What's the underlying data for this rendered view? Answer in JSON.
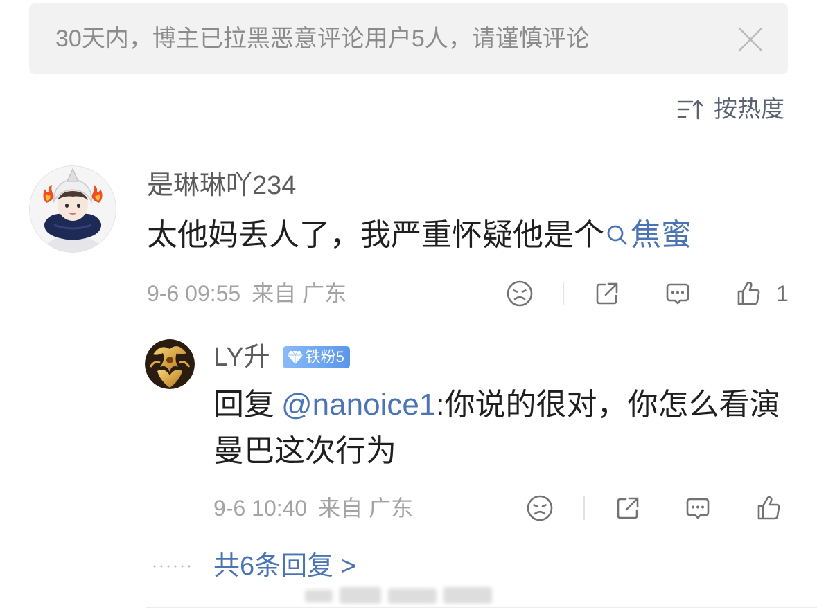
{
  "notice": {
    "text": "30天内，博主已拉黑恶意评论用户5人，请谨慎评论",
    "close_icon": "close-icon"
  },
  "sort": {
    "label": "按热度",
    "icon": "sort-icon"
  },
  "comment": {
    "username": "是琳琳吖234",
    "text": "太他妈丢人了，我严重怀疑他是个",
    "topic_icon": "search-icon",
    "topic_link": "焦蜜",
    "time": "9-6 09:55",
    "location": "来自 广东",
    "actions": [
      "dislike-icon",
      "share-icon",
      "comment-icon",
      "like-icon"
    ],
    "like_count": "1"
  },
  "reply": {
    "username": "LY升",
    "badge_icon": "diamond-icon",
    "badge": "铁粉5",
    "prefix": "回复",
    "mention": "@nanoice1",
    "text": ":你说的很对，你怎么看演曼巴这次行为",
    "time": "9-6 10:40",
    "location": "来自 广东",
    "actions": [
      "dislike-icon",
      "share-icon",
      "comment-icon",
      "like-icon"
    ]
  },
  "more_replies": {
    "label": "共6条回复 >"
  },
  "colors": {
    "link": "#4a74b3",
    "notice_bg": "#f2f2f2",
    "badge_start": "#88bbf7",
    "badge_end": "#5a96ea",
    "icon": "#727272"
  }
}
